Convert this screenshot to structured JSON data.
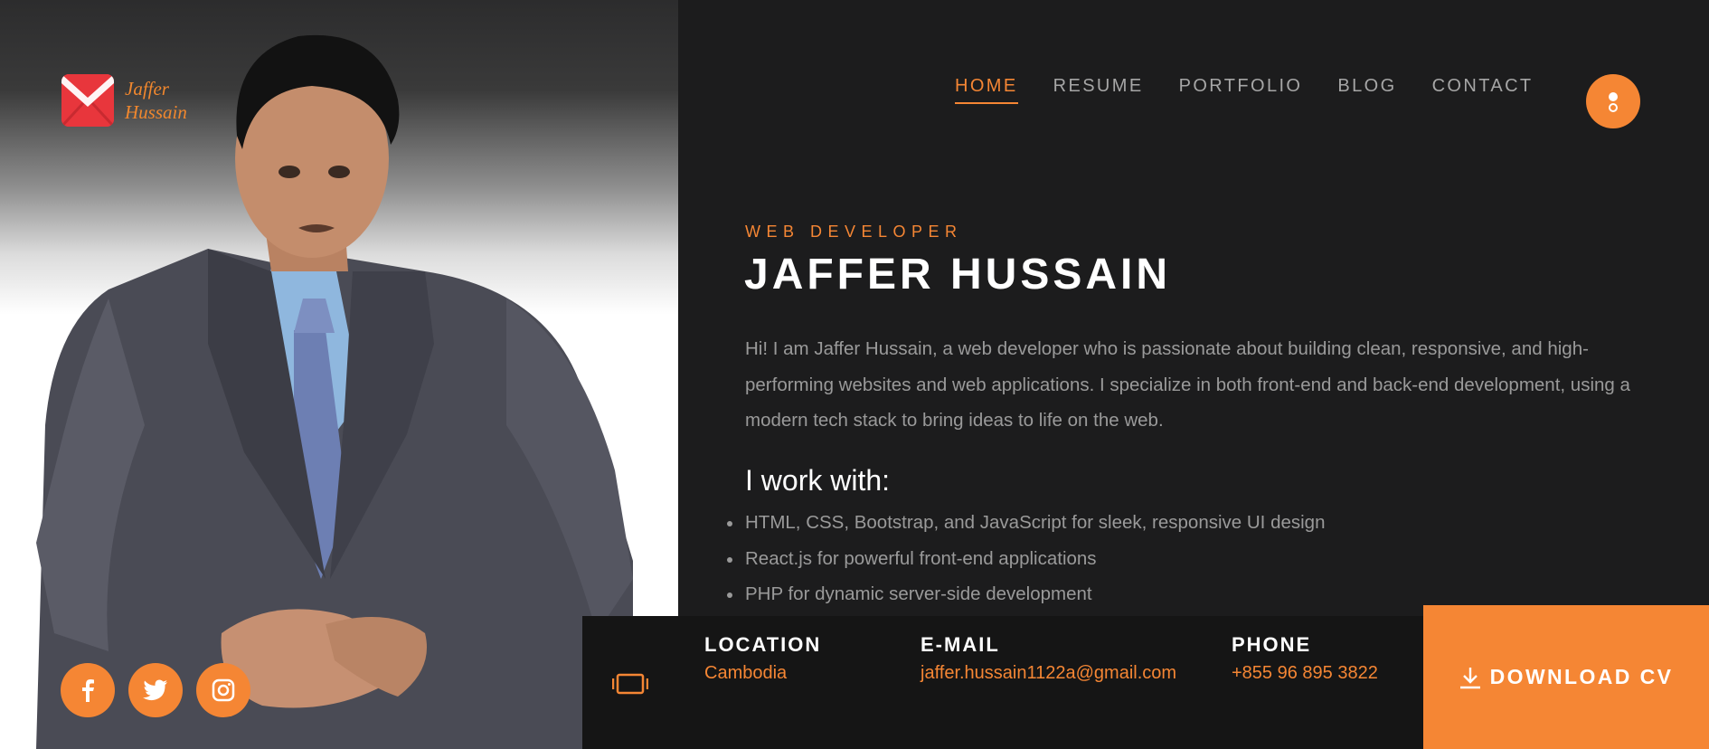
{
  "brand": {
    "line1": "Jaffer",
    "line2": "Hussain"
  },
  "nav": [
    {
      "label": "HOME",
      "active": true
    },
    {
      "label": "RESUME",
      "active": false
    },
    {
      "label": "PORTFOLIO",
      "active": false
    },
    {
      "label": "BLOG",
      "active": false
    },
    {
      "label": "CONTACT",
      "active": false
    }
  ],
  "hero": {
    "role": "WEB DEVELOPER",
    "name": "JAFFER HUSSAIN",
    "bio": "Hi! I am Jaffer Hussain, a web developer who is passionate about building clean, responsive, and high-performing websites and web applications. I specialize in both front-end and back-end development, using a modern tech stack to bring ideas to life on the web.",
    "works_title": "I work with:",
    "works": [
      "HTML, CSS, Bootstrap, and JavaScript for sleek, responsive UI design",
      "React.js for powerful front-end applications",
      "PHP for dynamic server-side development"
    ]
  },
  "info": {
    "location": {
      "label": "LOCATION",
      "value": "Cambodia"
    },
    "email": {
      "label": "E-MAIL",
      "value": "jaffer.hussain1122a@gmail.com"
    },
    "phone": {
      "label": "PHONE",
      "value": "+855 96 895 3822"
    }
  },
  "download": {
    "label": "DOWNLOAD CV"
  },
  "socials": [
    "facebook-icon",
    "twitter-icon",
    "instagram-icon"
  ],
  "colors": {
    "accent": "#f58634",
    "background": "#1c1c1d",
    "logo": "#e8363c"
  }
}
